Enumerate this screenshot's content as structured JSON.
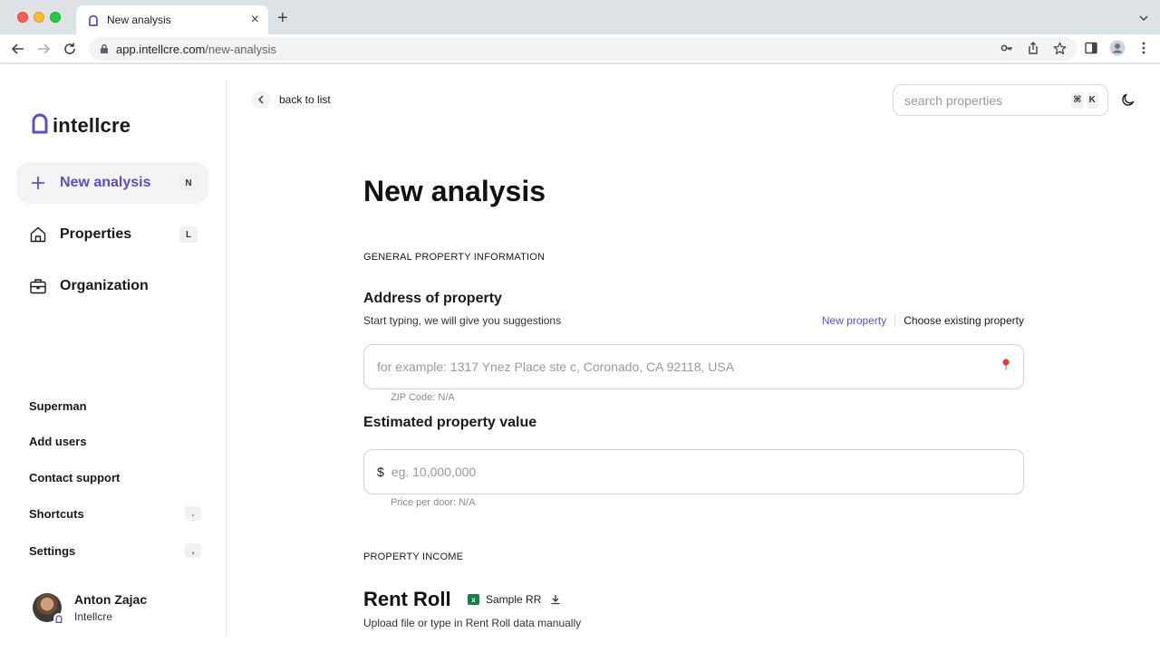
{
  "browser": {
    "tab_title": "New analysis",
    "url_host": "app.intellcre.com",
    "url_path": "/new-analysis"
  },
  "sidebar": {
    "logo_text": "intellcre",
    "nav": [
      {
        "label": "New analysis",
        "shortcut": "N",
        "icon": "plus-icon"
      },
      {
        "label": "Properties",
        "shortcut": "L",
        "icon": "home-icon"
      },
      {
        "label": "Organization",
        "shortcut": "",
        "icon": "briefcase-icon"
      }
    ],
    "links": [
      {
        "label": "Superman",
        "shortcut": ""
      },
      {
        "label": "Add users",
        "shortcut": ""
      },
      {
        "label": "Contact support",
        "shortcut": ""
      },
      {
        "label": "Shortcuts",
        "shortcut": "."
      },
      {
        "label": "Settings",
        "shortcut": ","
      }
    ],
    "user": {
      "name": "Anton Zajac",
      "org": "Intellcre"
    }
  },
  "header": {
    "back_label": "back to list",
    "search_placeholder": "search properties",
    "search_kbd_1": "⌘",
    "search_kbd_2": "K"
  },
  "main": {
    "title": "New analysis",
    "section_general": "GENERAL PROPERTY INFORMATION",
    "address": {
      "title": "Address of property",
      "subtitle": "Start typing, we will give you suggestions",
      "switch_new": "New property",
      "switch_existing": "Choose existing property",
      "placeholder": "for example: 1317 Ynez Place ste c, Coronado, CA 92118, USA",
      "hint": "ZIP Code: N/A"
    },
    "value": {
      "title": "Estimated property value",
      "currency": "$",
      "placeholder": "eg. 10,000,000",
      "hint": "Price per door: N/A"
    },
    "section_income": "PROPERTY INCOME",
    "rent_roll": {
      "title": "Rent Roll",
      "sample_label": "Sample RR",
      "subtitle": "Upload file or type in Rent Roll data manually"
    }
  },
  "colors": {
    "accent": "#5b4fc7",
    "active_bg": "#f4f4f6",
    "border": "#d2d2d2"
  }
}
